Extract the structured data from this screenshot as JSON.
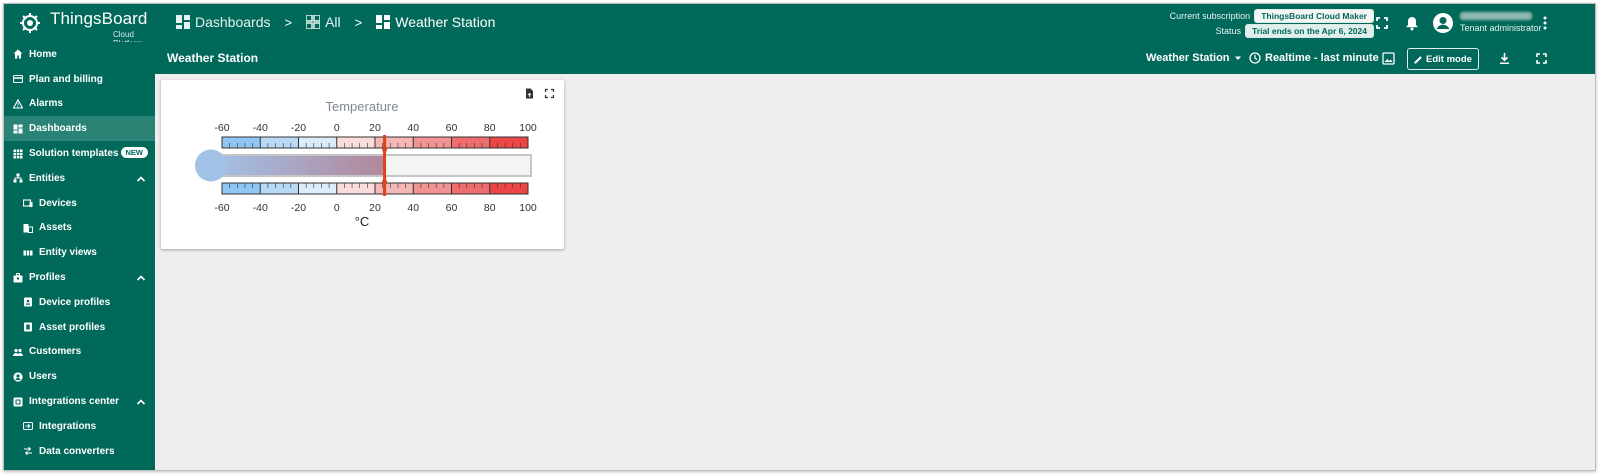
{
  "app": {
    "brand": "ThingsBoard",
    "brand_sub": "Cloud Platform"
  },
  "breadcrumb": {
    "items": [
      "Dashboards",
      "All",
      "Weather Station"
    ],
    "separator": ">"
  },
  "subscription": {
    "current_label": "Current subscription",
    "current_value": "ThingsBoard Cloud Maker",
    "status_label": "Status",
    "status_value": "Trial ends on the Apr 6, 2024"
  },
  "user": {
    "role": "Tenant administrator"
  },
  "sidebar": {
    "items": [
      {
        "label": "Home",
        "icon": "home-icon"
      },
      {
        "label": "Plan and billing",
        "icon": "billing-icon"
      },
      {
        "label": "Alarms",
        "icon": "warning-icon"
      },
      {
        "label": "Dashboards",
        "icon": "dashboard-icon",
        "active": true
      },
      {
        "label": "Solution templates",
        "icon": "grid-icon",
        "badge": "NEW"
      },
      {
        "label": "Entities",
        "icon": "entities-icon",
        "expanded": true
      },
      {
        "label": "Devices",
        "icon": "devices-icon",
        "sub": true
      },
      {
        "label": "Assets",
        "icon": "assets-icon",
        "sub": true
      },
      {
        "label": "Entity views",
        "icon": "entity-views-icon",
        "sub": true
      },
      {
        "label": "Profiles",
        "icon": "profiles-icon",
        "expanded": true
      },
      {
        "label": "Device profiles",
        "icon": "device-profiles-icon",
        "sub": true
      },
      {
        "label": "Asset profiles",
        "icon": "asset-profiles-icon",
        "sub": true
      },
      {
        "label": "Customers",
        "icon": "customers-icon"
      },
      {
        "label": "Users",
        "icon": "users-icon"
      },
      {
        "label": "Integrations center",
        "icon": "integrations-center-icon",
        "expanded": true
      },
      {
        "label": "Integrations",
        "icon": "integrations-icon",
        "sub": true
      },
      {
        "label": "Data converters",
        "icon": "data-converters-icon",
        "sub": true
      }
    ]
  },
  "dashboard": {
    "title": "Weather Station",
    "state": "Weather Station",
    "timewindow": "Realtime - last minute",
    "edit_label": "Edit mode"
  },
  "widget": {
    "title": "Temperature",
    "units": "°C",
    "min": -60,
    "max": 100,
    "value": 25,
    "major_ticks": [
      "-60",
      "-40",
      "-20",
      "0",
      "20",
      "40",
      "60",
      "80",
      "100"
    ]
  },
  "colors": {
    "primary": "#01695a",
    "active_nav": "#2a8374",
    "needle": "#e0431a",
    "cold": "#90c6f4",
    "hot": "#ef3d3d"
  }
}
